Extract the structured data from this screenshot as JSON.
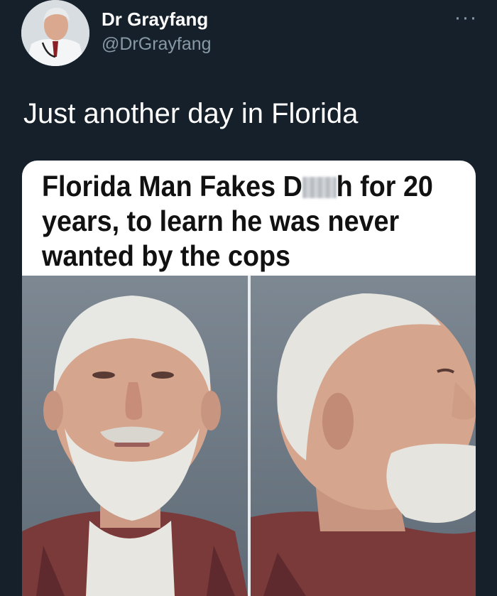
{
  "user": {
    "display_name": "Dr Grayfang",
    "handle": "@DrGrayfang"
  },
  "menu_icon_glyph": "···",
  "tweet": {
    "text": "Just another day in Florida"
  },
  "meme": {
    "headline_part1": "Florida Man Fakes D",
    "headline_part2": "h for 20 years, to learn he was never wanted by the cops",
    "photo_description_panels": [
      "front",
      "profile"
    ]
  },
  "colors": {
    "background": "#15202b",
    "secondary_text": "#8899a6"
  }
}
